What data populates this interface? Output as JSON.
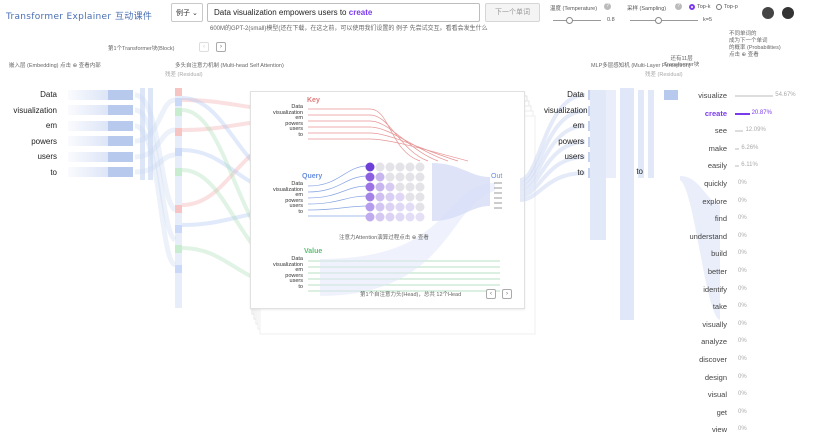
{
  "app": {
    "title": "Transformer Explainer",
    "title_cn": "互动课件"
  },
  "header": {
    "example_label": "例子",
    "prompt_text": "Data visualization empowers users to",
    "predicted_word": "create",
    "next_button": "下一个单词",
    "hint": "600M的GPT-2(small)模型(还在下载，在这之前，可以使用我们设置的 例子 先尝试交互。看看会发生什么"
  },
  "controls": {
    "temperature_label": "温度 (Temperature)",
    "temperature_value": "0.8",
    "sampling_label": "采样 (Sampling)",
    "topk_label": "Top-k",
    "topp_label": "Top-p",
    "k_value": "k=5",
    "colors": {
      "accent": "#7c3aed"
    }
  },
  "labels": {
    "block": "第1个Transformer块(Block)",
    "embedding": "嵌入层 (Embedding) 点击",
    "embedding_view": "查看内部",
    "residual1": "残差 (Residual)",
    "mhsa": "多头自注意力机制 (Multi-head Self Attention)",
    "mlp": "MLP多层感知机 (Multi-Layer Perceptron)",
    "residual2": "残差 (Residual)",
    "add_block": "还有11层",
    "add_block2": "Transformer块",
    "prob_title_1": "不同单词的",
    "prob_title_2": "成为下一个单词",
    "prob_title_3": "的概率 (Probabilities)",
    "prob_click": "点击",
    "prob_view": "查看",
    "key": "Key",
    "query": "Query",
    "value": "Value",
    "out": "Out",
    "attention_hint": "注意力Attention演算过程点击",
    "attention_view": "查看",
    "head_info": "第1个自注意力头(Head)，总共 12个Head"
  },
  "tokens": [
    "Data",
    "visualization",
    "em",
    "powers",
    "users",
    "to"
  ],
  "outputs": [
    {
      "word": "visualize",
      "pct": "54.67%"
    },
    {
      "word": "create",
      "pct": "20.87%"
    },
    {
      "word": "see",
      "pct": "12.09%"
    },
    {
      "word": "make",
      "pct": "6.26%"
    },
    {
      "word": "easily",
      "pct": "6.11%"
    },
    {
      "word": "quickly",
      "pct": "0%"
    },
    {
      "word": "explore",
      "pct": "0%"
    },
    {
      "word": "find",
      "pct": "0%"
    },
    {
      "word": "understand",
      "pct": "0%"
    },
    {
      "word": "build",
      "pct": "0%"
    },
    {
      "word": "better",
      "pct": "0%"
    },
    {
      "word": "identify",
      "pct": "0%"
    },
    {
      "word": "take",
      "pct": "0%"
    },
    {
      "word": "visually",
      "pct": "0%"
    },
    {
      "word": "analyze",
      "pct": "0%"
    },
    {
      "word": "discover",
      "pct": "0%"
    },
    {
      "word": "design",
      "pct": "0%"
    },
    {
      "word": "visual",
      "pct": "0%"
    },
    {
      "word": "get",
      "pct": "0%"
    },
    {
      "word": "view",
      "pct": "0%"
    }
  ]
}
